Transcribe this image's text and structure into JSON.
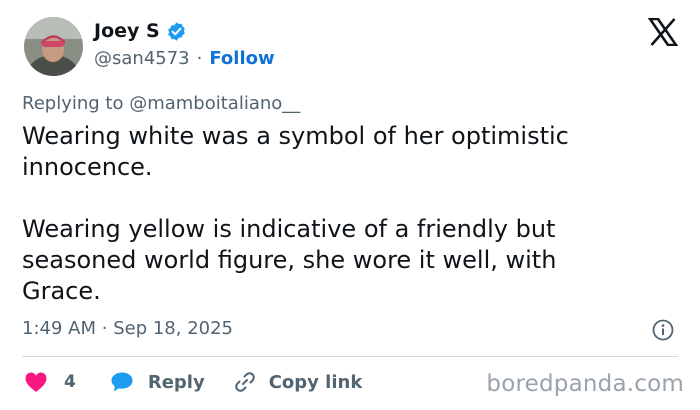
{
  "author": {
    "display_name": "Joey S",
    "handle": "@san4573",
    "separator": "·",
    "follow_label": "Follow",
    "verified": true
  },
  "reply_context": {
    "prefix": "Replying to ",
    "mention": "@mamboitaliano__"
  },
  "tweet": {
    "text": "Wearing white was a symbol of her optimistic\ninnocence.\n\nWearing yellow is indicative of a friendly but\nseasoned world figure, she wore it well, with\nGrace.",
    "time": "1:49 AM",
    "separator": "·",
    "date": "Sep 18, 2025"
  },
  "actions": {
    "like_count": "4",
    "reply_label": "Reply",
    "copy_link_label": "Copy link"
  },
  "watermark": "boredpanda.com",
  "colors": {
    "link_blue": "#0f73d6",
    "verified_blue": "#1d9bf0",
    "like_red": "#f91880",
    "reply_blue": "#1d9bf0",
    "muted": "#536471",
    "text": "#0f1419"
  },
  "icons": {
    "avatar": "profile-photo",
    "verified": "verified-badge-icon",
    "logo": "x-logo-icon",
    "info": "info-icon",
    "like": "heart-icon",
    "reply": "speech-bubble-icon",
    "copy": "link-icon"
  }
}
